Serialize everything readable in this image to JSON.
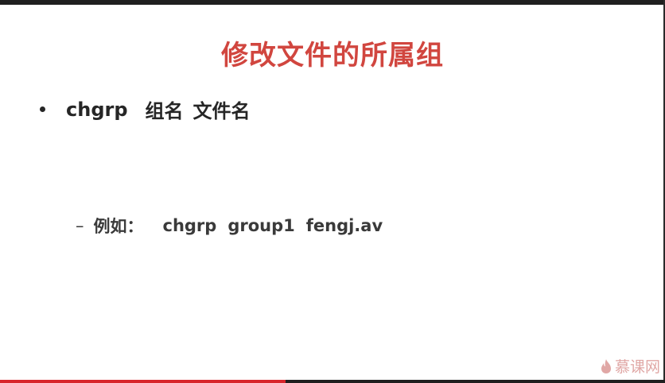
{
  "slide": {
    "title": "修改文件的所属组",
    "bullet": {
      "command": "chgrp",
      "arg1": "组名",
      "arg2": "文件名"
    },
    "example": {
      "dash": "–",
      "label": "例如：",
      "command": "chgrp",
      "arg1": "group1",
      "arg2": "fengj.av"
    }
  },
  "watermark": {
    "text": "慕课网",
    "icon": "flame-icon"
  },
  "playback": {
    "progress": 0.43
  },
  "colors": {
    "title": "#d1463f",
    "body_text": "#262626",
    "progress": "#d8262c",
    "watermark": "#e0a7a5"
  }
}
